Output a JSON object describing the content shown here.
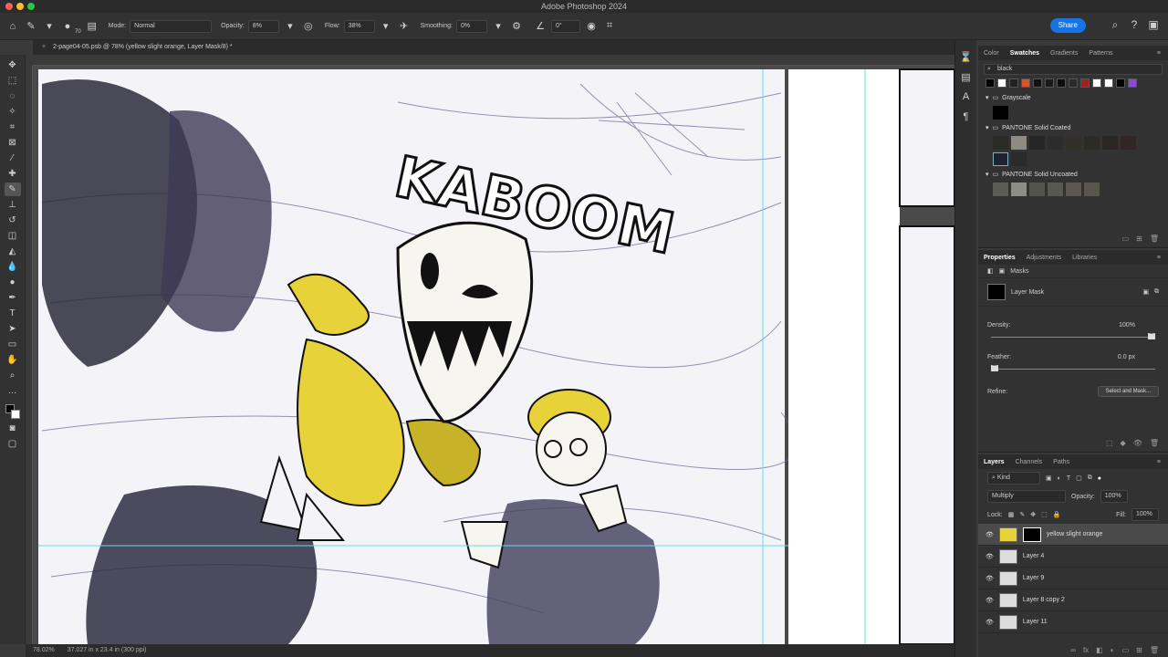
{
  "window": {
    "title": "Adobe Photoshop 2024"
  },
  "colors": {
    "accent": "#1473e6",
    "layer_thumb_yellow": "#e8d23a"
  },
  "options_bar": {
    "home_icon": "home-icon",
    "brush_size": "70",
    "mode_label": "Mode:",
    "mode_value": "Normal",
    "opacity_label": "Opacity:",
    "opacity_value": "8%",
    "flow_label": "Flow:",
    "flow_value": "38%",
    "smoothing_label": "Smoothing:",
    "smoothing_value": "0%",
    "angle_value": "0°"
  },
  "header": {
    "share_label": "Share"
  },
  "document_tab": {
    "title": "2-page04-05.psb @ 78% (yellow slight orange, Layer Mask/8) *"
  },
  "status": {
    "zoom": "78.02%",
    "doc_size": "37.027 in x 23.4 in (300 ppi)"
  },
  "swatches_panel": {
    "tabs": [
      "Color",
      "Swatches",
      "Gradients",
      "Patterns"
    ],
    "active_tab": "Swatches",
    "search_value": "black",
    "folders": [
      "Grayscale",
      "PANTONE Solid Coated",
      "PANTONE Solid Uncoated"
    ]
  },
  "properties_panel": {
    "tabs": [
      "Properties",
      "Adjustments",
      "Libraries"
    ],
    "active_tab": "Properties",
    "masks_label": "Masks",
    "layer_mask_label": "Layer Mask",
    "density_label": "Density:",
    "density_value": "100%",
    "density_fraction": 1.0,
    "feather_label": "Feather:",
    "feather_value": "0.0 px",
    "feather_fraction": 0.0,
    "refine_label": "Refine:",
    "select_mask_label": "Select and Mask..."
  },
  "layers_panel": {
    "tabs": [
      "Layers",
      "Channels",
      "Paths"
    ],
    "active_tab": "Layers",
    "filter_kind": "Kind",
    "blend_mode": "Multiply",
    "opacity_label": "Opacity:",
    "opacity_value": "100%",
    "lock_label": "Lock:",
    "fill_label": "Fill:",
    "fill_value": "100%",
    "layers": [
      {
        "name": "yellow slight orange",
        "selected": true
      },
      {
        "name": "Layer 4",
        "selected": false
      },
      {
        "name": "Layer 9",
        "selected": false
      },
      {
        "name": "Layer 8 copy 2",
        "selected": false
      },
      {
        "name": "Layer 11",
        "selected": false
      }
    ]
  },
  "artwork": {
    "sound_effect": "KABOOM"
  }
}
